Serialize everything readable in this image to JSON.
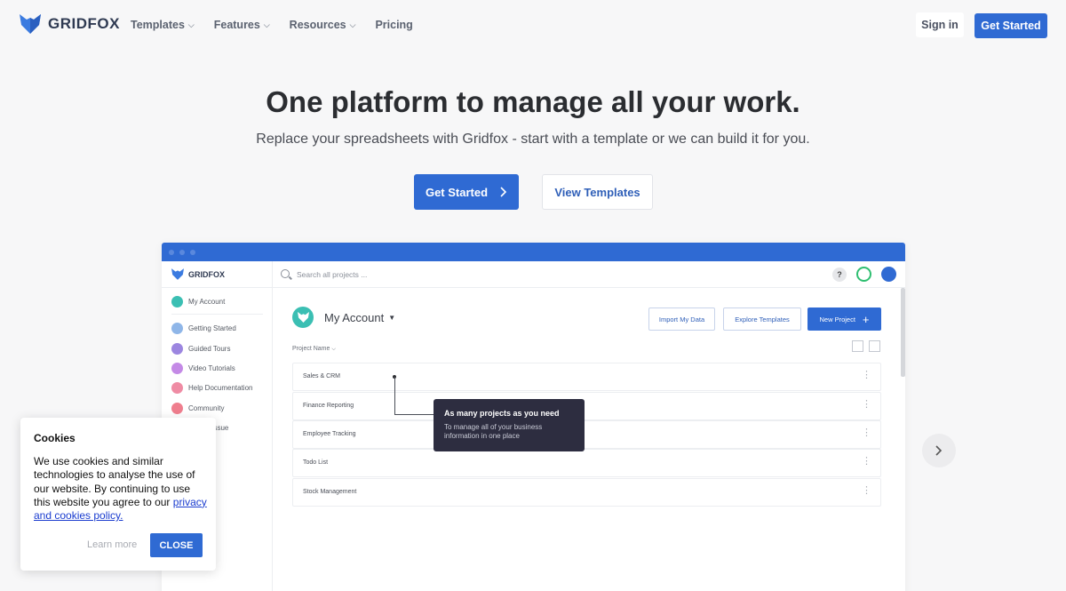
{
  "nav": {
    "brand": "GRIDFOX",
    "items": [
      {
        "label": "Templates",
        "dropdown": true
      },
      {
        "label": "Features",
        "dropdown": true
      },
      {
        "label": "Resources",
        "dropdown": true
      },
      {
        "label": "Pricing",
        "dropdown": false
      }
    ],
    "sign_in": "Sign in",
    "cta": "Get Started"
  },
  "hero": {
    "title": "One platform to manage all your work.",
    "subtitle": "Replace your spreadsheets with Gridfox - start with a template or we can build it for you.",
    "primary_button": "Get Started",
    "secondary_button": "View Templates"
  },
  "mock": {
    "brand": "GRIDFOX",
    "search_placeholder": "Search all projects ...",
    "help_label": "?",
    "sidebar": [
      {
        "label": "My Account",
        "color": "#3bbfb3",
        "icon": "fox-icon"
      },
      {
        "label": "Getting Started",
        "color": "#8fb6e8",
        "icon": "flag-icon"
      },
      {
        "label": "Guided Tours",
        "color": "#9c86e0",
        "icon": "compass-icon"
      },
      {
        "label": "Video Tutorials",
        "color": "#c48ae6",
        "icon": "play-icon"
      },
      {
        "label": "Help Documentation",
        "color": "#ef8ca4",
        "icon": "help-icon"
      },
      {
        "label": "Community",
        "color": "#ef7e8e",
        "icon": "community-icon"
      },
      {
        "label": "Report Issue",
        "color": "#f0a06a",
        "icon": "bug-icon"
      }
    ],
    "account_title": "My Account",
    "import_button": "Import My Data",
    "explore_button": "Explore Templates",
    "new_project_button": "New Project",
    "column_header": "Project Name",
    "projects": [
      "Sales & CRM",
      "Finance Reporting",
      "Employee Tracking",
      "Todo List",
      "Stock Management"
    ],
    "tooltip": {
      "title": "As many projects as you need",
      "body": "To manage all of your business information in one place"
    }
  },
  "cookie": {
    "title": "Cookies",
    "body": "We use cookies and similar technologies to analyse the use of our website. By continuing to use this website you agree to our",
    "link": "privacy and cookies policy.",
    "learn_more": "Learn more",
    "close": "CLOSE"
  },
  "colors": {
    "brand_blue": "#2f6ad3",
    "tooltip_bg": "#2d2d40"
  }
}
